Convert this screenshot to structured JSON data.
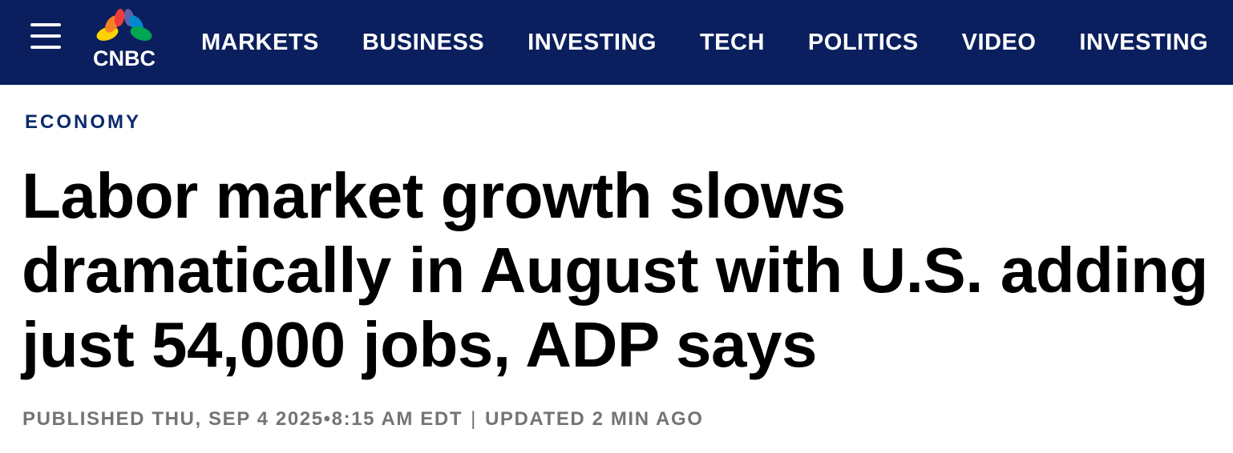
{
  "header": {
    "brand": "CNBC",
    "logo_colors": [
      "#f58220",
      "#ffd200",
      "#00a651",
      "#0089d0",
      "#6460aa",
      "#ef3b39"
    ],
    "background": "#0b1f5e",
    "nav": [
      {
        "label": "MARKETS"
      },
      {
        "label": "BUSINESS"
      },
      {
        "label": "INVESTING"
      },
      {
        "label": "TECH"
      },
      {
        "label": "POLITICS"
      },
      {
        "label": "VIDEO"
      },
      {
        "label": "INVESTING"
      }
    ]
  },
  "article": {
    "kicker": "ECONOMY",
    "headline": "Labor market growth slows dramatically in August with U.S. adding just 54,000 jobs, ADP says",
    "published": "PUBLISHED THU, SEP 4 2025•8:15 AM EDT",
    "separator": "|",
    "updated": "UPDATED 2 MIN AGO"
  }
}
